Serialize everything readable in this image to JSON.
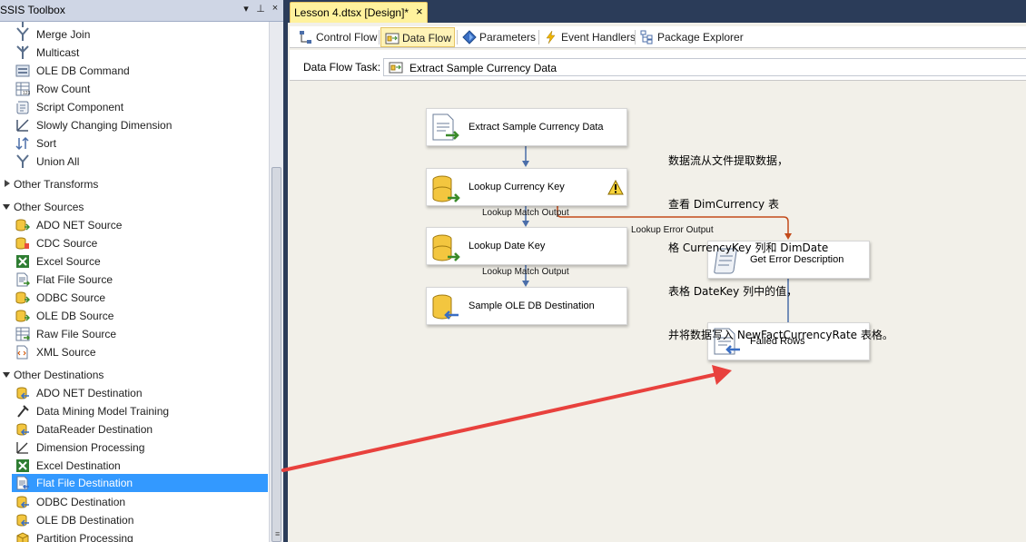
{
  "toolbox": {
    "title": "SSIS Toolbox",
    "dropdown_glyph": "▾",
    "pin_glyph": "⊥",
    "close_glyph": "×",
    "scroll_grip_glyph": "≡",
    "items": [
      {
        "label": "Merge Join",
        "icon": "merge-join-icon"
      },
      {
        "label": "Multicast",
        "icon": "multicast-icon"
      },
      {
        "label": "OLE DB Command",
        "icon": "ole-db-command-icon"
      },
      {
        "label": "Row Count",
        "icon": "row-count-icon"
      },
      {
        "label": "Script Component",
        "icon": "script-component-icon"
      },
      {
        "label": "Slowly Changing Dimension",
        "icon": "slowly-changing-dimension-icon"
      },
      {
        "label": "Sort",
        "icon": "sort-icon"
      },
      {
        "label": "Union All",
        "icon": "union-all-icon"
      }
    ],
    "other_transforms": {
      "label": "Other Transforms",
      "expanded": false
    },
    "other_sources": {
      "label": "Other Sources",
      "expanded": true,
      "items": [
        {
          "label": "ADO NET Source",
          "icon": "ado-net-source-icon"
        },
        {
          "label": "CDC Source",
          "icon": "cdc-source-icon"
        },
        {
          "label": "Excel Source",
          "icon": "excel-source-icon"
        },
        {
          "label": "Flat File Source",
          "icon": "flat-file-source-icon"
        },
        {
          "label": "ODBC Source",
          "icon": "odbc-source-icon"
        },
        {
          "label": "OLE DB Source",
          "icon": "ole-db-source-icon"
        },
        {
          "label": "Raw File Source",
          "icon": "raw-file-source-icon"
        },
        {
          "label": "XML Source",
          "icon": "xml-source-icon"
        }
      ]
    },
    "other_destinations": {
      "label": "Other Destinations",
      "expanded": true,
      "items": [
        {
          "label": "ADO NET Destination",
          "icon": "ado-net-destination-icon"
        },
        {
          "label": "Data Mining Model Training",
          "icon": "data-mining-model-training-icon"
        },
        {
          "label": "DataReader Destination",
          "icon": "datareader-destination-icon"
        },
        {
          "label": "Dimension Processing",
          "icon": "dimension-processing-icon"
        },
        {
          "label": "Excel Destination",
          "icon": "excel-destination-icon"
        },
        {
          "label": "Flat File Destination",
          "icon": "flat-file-destination-icon",
          "selected": true
        },
        {
          "label": "ODBC Destination",
          "icon": "odbc-destination-icon"
        },
        {
          "label": "OLE DB Destination",
          "icon": "ole-db-destination-icon"
        },
        {
          "label": "Partition Processing",
          "icon": "partition-processing-icon"
        }
      ]
    }
  },
  "document": {
    "tab_title": "Lesson 4.dtsx [Design]*",
    "close_glyph": "×",
    "designer_tabs": [
      {
        "label": "Control Flow",
        "icon": "control-flow-icon",
        "active": false
      },
      {
        "label": "Data Flow",
        "icon": "data-flow-icon",
        "active": true
      },
      {
        "label": "Parameters",
        "icon": "parameters-icon",
        "active": false
      },
      {
        "label": "Event Handlers",
        "icon": "event-handlers-icon",
        "active": false
      },
      {
        "label": "Package Explorer",
        "icon": "package-explorer-icon",
        "active": false
      }
    ],
    "task_label": "Data Flow Task:",
    "task_value": "Extract Sample Currency Data"
  },
  "canvas": {
    "nodes": [
      {
        "id": "extract",
        "label": "Extract Sample Currency Data",
        "icon": "flat-file-source-icon",
        "warning": false
      },
      {
        "id": "lookup-currency",
        "label": "Lookup Currency Key",
        "icon": "lookup-icon",
        "warning": true
      },
      {
        "id": "lookup-date",
        "label": "Lookup Date Key",
        "icon": "lookup-icon",
        "warning": false
      },
      {
        "id": "ole-dest",
        "label": "Sample OLE DB Destination",
        "icon": "ole-db-destination-icon",
        "warning": false
      },
      {
        "id": "get-error",
        "label": "Get Error Description",
        "icon": "script-component-icon",
        "warning": false
      },
      {
        "id": "failed-rows",
        "label": "Failed Rows",
        "icon": "flat-file-destination-icon",
        "warning": false
      }
    ],
    "path_labels": {
      "match1": "Lookup Match Output",
      "error": "Lookup Error Output",
      "match2": "Lookup Match Output"
    },
    "annotation": [
      "数据流从文件提取数据，",
      "查看 DimCurrency 表",
      "格 CurrencyKey 列和 DimDate",
      "表格 DateKey 列中的值，",
      "并将数据写入 NewFactCurrencyRate 表格。"
    ],
    "colors": {
      "canvas_bg": "#f2f0e9",
      "path_normal": "#4b6ea9",
      "path_error": "#c34a1a",
      "callout_arrow": "#e8413d",
      "selection": "#3399ff",
      "tab_active": "#fff29d"
    }
  }
}
